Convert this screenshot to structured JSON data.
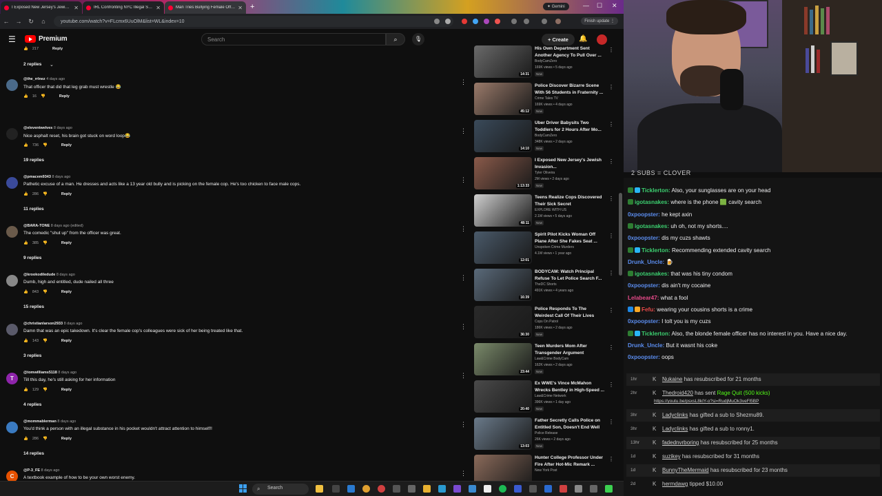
{
  "browser": {
    "tabs": [
      {
        "label": "I Exposed New Jersey's Jewish..."
      },
      {
        "label": "IRL Confronting NYC Illegal Sc..."
      },
      {
        "label": "Man Tries Bullying Female Offi..."
      }
    ],
    "gemini_label": "Gemini",
    "url": "youtube.com/watch?v=FLcmx6UuOlM&list=WL&index=10",
    "finish_update": "Finish update"
  },
  "youtube": {
    "logo_text": "Premium",
    "search_placeholder": "Search",
    "create_label": "Create"
  },
  "comments": [
    {
      "top_replies": "2 replies",
      "author": "@the_rrlnez",
      "age": "4 days ago",
      "text": "That officer that did that leg grab must wrestle 😂",
      "likes": "16",
      "reply": "Reply",
      "avatar_color": "#4a6a8a"
    },
    {
      "author": "@eleventwelves",
      "age": "8 days ago",
      "text": "Nice asphalt reset, his brain got stuck on word loop😂",
      "likes": "736",
      "reply": "Reply",
      "replies": "19 replies",
      "avatar_color": "#222222"
    },
    {
      "author": "@pmacem9343",
      "age": "8 days ago",
      "text": "Pathetic excuse of a man. He dresses and acts like a 13 year old bully and is picking on the female cop. He's too chicken to face male cops.",
      "likes": "286",
      "reply": "Reply",
      "replies": "11 replies",
      "avatar_color": "#3a4a9a"
    },
    {
      "author": "@BARA-TONE",
      "age": "8 days ago (edited)",
      "text": "The comedic \"shut up\" from the officer was great.",
      "likes": "385",
      "reply": "Reply",
      "replies": "9 replies",
      "avatar_color": "#6a5a4a"
    },
    {
      "author": "@krookodiledude",
      "age": "8 days ago",
      "text": "Dumb, high and entitled, dude nailed all three",
      "likes": "843",
      "reply": "Reply",
      "replies": "15 replies",
      "avatar_color": "#888888"
    },
    {
      "author": "@christianlarson2933",
      "age": "8 days ago",
      "text": "Damn that was an epic takedown. It's clear the female cop's colleagues were sick of her being treated like that.",
      "likes": "143",
      "reply": "Reply",
      "replies": "3 replies",
      "avatar_color": "#5a5a6a"
    },
    {
      "author": "@tomwilliams5118",
      "age": "8 days ago",
      "text": "Till this day, he's still asking for her information",
      "likes": "129",
      "reply": "Reply",
      "replies": "4 replies",
      "avatar_color": "#8e24aa",
      "initial": "T"
    },
    {
      "author": "@mommablerman",
      "age": "8 days ago",
      "text": "You'd think a person with an illegal substance in his pocket wouldn't attract attention to himself!!",
      "likes": "286",
      "reply": "Reply",
      "replies": "14 replies",
      "avatar_color": "#3a7ac0"
    },
    {
      "author": "@P-3_FE",
      "age": "8 days ago",
      "text": "A textbook example of how to be your own worst enemy.",
      "likes": "243",
      "reply": "Reply",
      "avatar_color": "#e65100",
      "initial": "C"
    }
  ],
  "sidebar": [
    {
      "title": "His Own Department Sent Another Agency To Pull Over ...",
      "channel": "BodyCamZero",
      "meta": "169K views • 5 days ago",
      "duration": "14:31",
      "badge": "New",
      "color": "#6a6a6a"
    },
    {
      "title": "Police Discover Bizarre Scene With 56 Students in Fraternity ...",
      "channel": "Crime Tales TV",
      "meta": "169K views • 4 days ago",
      "duration": "45:12",
      "badge": "New",
      "color": "#9a7a6a"
    },
    {
      "title": "Uber Driver Babysits Two Toddlers for 2 Hours After Mo...",
      "channel": "BodyCamZero",
      "meta": "348K views • 2 days ago",
      "duration": "14:10",
      "badge": "New",
      "color": "#3a4a5a"
    },
    {
      "title": "I Exposed New Jersey's Jewish Invasion...",
      "channel": "Tyler Oliveira",
      "meta": "2M views • 2 days ago",
      "duration": "1:13:33",
      "badge": "New",
      "color": "#8a5a4a"
    },
    {
      "title": "Teens Realize Cops Discovered Their Sick Secret",
      "channel": "EXPLORE WITH US",
      "meta": "2.1M views • 5 days ago",
      "duration": "48:11",
      "badge": "New",
      "color": "#cfcfcf"
    },
    {
      "title": "Spirit Pilot Kicks Woman Off Plane After She Fakes Seat ...",
      "channel": "Unspoken Crime Murders",
      "meta": "4.1M views • 1 year ago",
      "duration": "12:01",
      "badge": "",
      "color": "#4a5a6a"
    },
    {
      "title": "BODYCAM: Watch Principal Refuse To Let Police Search F...",
      "channel": "TheDC Shorts",
      "meta": "491K views • 4 years ago",
      "duration": "16:39",
      "badge": "",
      "color": "#5a6a7a"
    },
    {
      "title": "Police Responds To The Weirdest Call Of Their Lives",
      "channel": "Cops On Patrol",
      "meta": "186K views • 2 days ago",
      "duration": "36:30",
      "badge": "New",
      "color": "#2a2a2a"
    },
    {
      "title": "Teen Murders Mom After Transgender Argument",
      "channel": "Law&Crime BodyCam",
      "meta": "162K views • 2 days ago",
      "duration": "23:44",
      "badge": "New",
      "color": "#7a8a6a"
    },
    {
      "title": "Ex WWE's Vince McMahon Wrecks Bentley in High-Speed ...",
      "channel": "Law&Crime Network",
      "meta": "396K views • 1 day ago",
      "duration": "20:40",
      "badge": "New",
      "color": "#4a4a4a"
    },
    {
      "title": "Father Secretly Calls Police on Entitled Son, Doesn't End Well",
      "channel": "Police Release",
      "meta": "26K views • 2 days ago",
      "duration": "13:03",
      "badge": "New",
      "color": "#6a7a8a"
    },
    {
      "title": "Hunter College Professor Under Fire After Hot-Mic Remark ...",
      "channel": "New York Post",
      "meta": "",
      "duration": "",
      "badge": "",
      "color": "#8a6a5a"
    }
  ],
  "stream": {
    "clover_text": "2 SUBS = CLOVER",
    "chat": [
      {
        "user": "Ticklerton:",
        "msg": "Also, your sunglasses are on your head",
        "color": "#3cd070",
        "badges": [
          "#2e7d32",
          "#29b6f6"
        ]
      },
      {
        "user": "igotasnakes:",
        "msg": "where is the phone 🟩 cavity search",
        "color": "#3cd070",
        "badges": [
          "#2e7d32"
        ]
      },
      {
        "user": "0xpoopster:",
        "msg": "he kept axin",
        "color": "#5b8def",
        "badges": []
      },
      {
        "user": "igotasnakes:",
        "msg": "uh oh, not my shorts....",
        "color": "#3cd070",
        "badges": [
          "#2e7d32"
        ]
      },
      {
        "user": "0xpoopster:",
        "msg": "dis my cuzs shawts",
        "color": "#5b8def",
        "badges": []
      },
      {
        "user": "Ticklerton:",
        "msg": "Recommending extended cavity search",
        "color": "#3cd070",
        "badges": [
          "#2e7d32",
          "#29b6f6"
        ]
      },
      {
        "user": "Drunk_Uncle:",
        "msg": "🍺",
        "color": "#5b8def",
        "badges": []
      },
      {
        "user": "igotasnakes:",
        "msg": "that was his tiny condom",
        "color": "#3cd070",
        "badges": [
          "#2e7d32"
        ]
      },
      {
        "user": "0xpoopster:",
        "msg": "dis ain't my cocaine",
        "color": "#5b8def",
        "badges": []
      },
      {
        "user": "Lelabear47:",
        "msg": "what a fool",
        "color": "#e84a8a",
        "badges": []
      },
      {
        "user": "Fefu:",
        "msg": "wearing your cousins shorts is a crime",
        "color": "#e84a4a",
        "badges": [
          "#1e88e5",
          "#f9a825"
        ]
      },
      {
        "user": "0xpoopster:",
        "msg": "I tolt you is my cuzs",
        "color": "#5b8def",
        "badges": []
      },
      {
        "user": "Ticklerton:",
        "msg": "Also, the blonde female officer has no interest in you. Have a nice day.",
        "color": "#3cd070",
        "badges": [
          "#2e7d32",
          "#29b6f6"
        ]
      },
      {
        "user": "Drunk_Uncle:",
        "msg": "But it wasnt his coke",
        "color": "#5b8def",
        "badges": []
      },
      {
        "user": "0xpoopster:",
        "msg": "oops",
        "color": "#5b8def",
        "badges": []
      }
    ],
    "events": [
      {
        "time": "1hr",
        "user": "Nukaine",
        "msg": "has resubscribed for 21 months"
      },
      {
        "time": "2hr",
        "user": "Thedroid420",
        "msg": "has sent",
        "extra": "Rage Quit (500 kicks)",
        "link": "https://youtu.be/psxsL8kIY-o?si=RudjMuOk3veFl5BP"
      },
      {
        "time": "3hr",
        "user": "Ladyclinks",
        "msg": "has gifted a sub to Shezmu89."
      },
      {
        "time": "3hr",
        "user": "Ladyclinks",
        "msg": "has gifted a sub to ronny1."
      },
      {
        "time": "13hr",
        "user": "fadednvrboring",
        "msg": "has resubscribed for 25 months"
      },
      {
        "time": "1d",
        "user": "suzikey",
        "msg": "has resubscribed for 31 months"
      },
      {
        "time": "1d",
        "user": "BunnyTheMermaid",
        "msg": "has resubscribed for 23 months"
      },
      {
        "time": "2d",
        "user": "hermdawg",
        "msg": "tipped $10.00"
      }
    ]
  },
  "taskbar": {
    "search_label": "Search"
  }
}
